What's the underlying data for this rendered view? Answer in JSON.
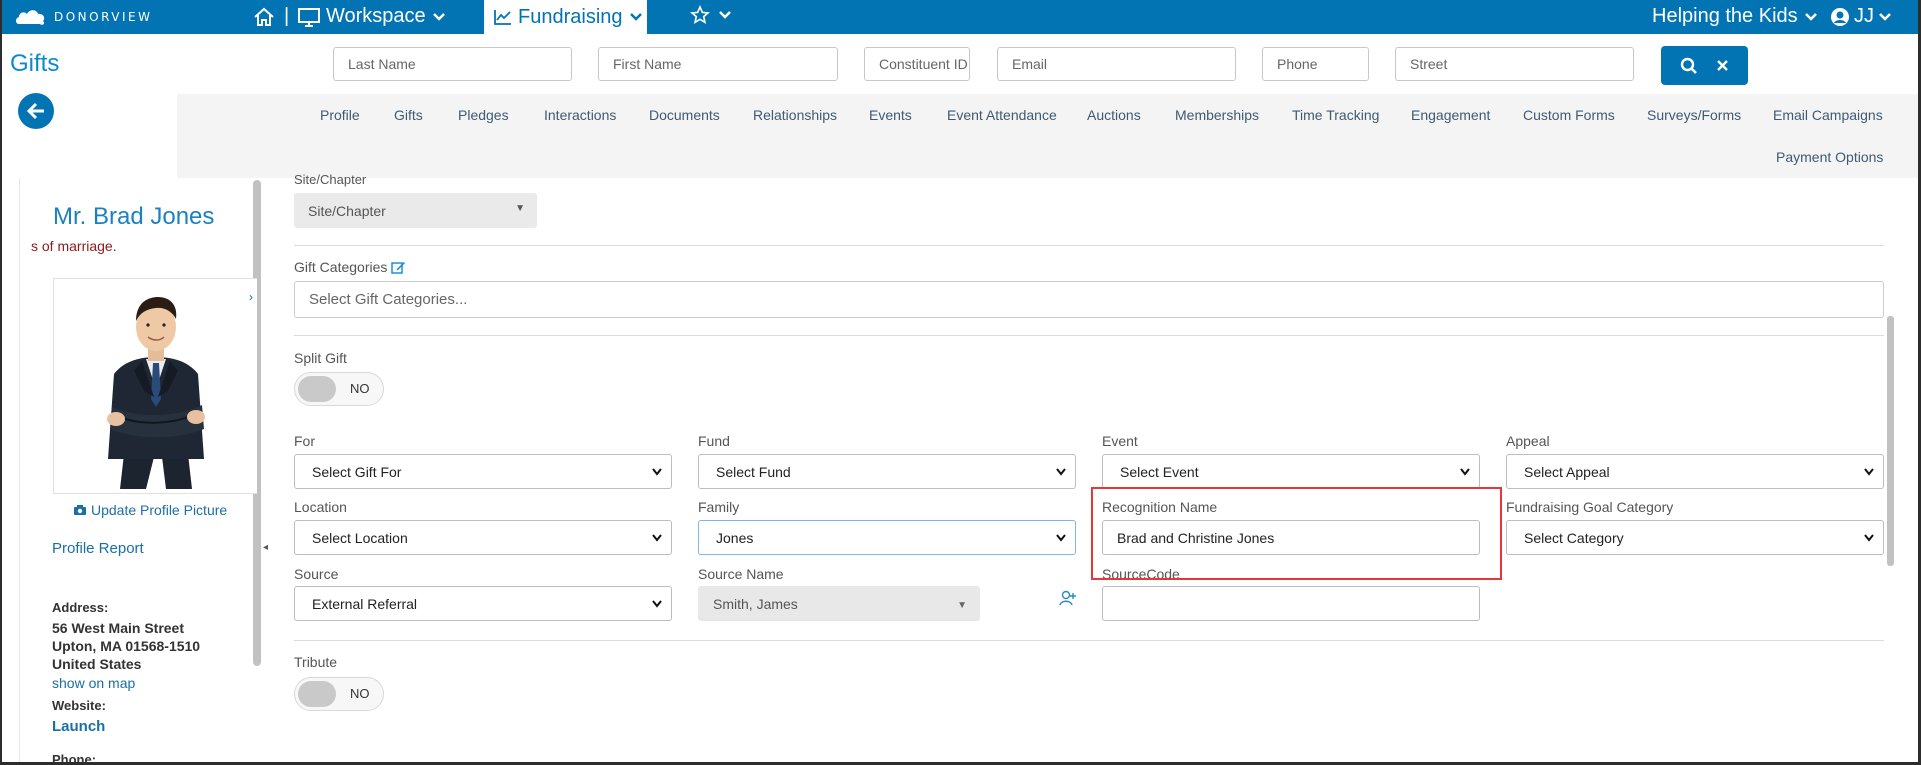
{
  "brand": {
    "logo_text": "DONORVIEW"
  },
  "topnav": {
    "separator": "|",
    "workspace_label": "Workspace",
    "fundraising_label": "Fundraising",
    "org_label": "Helping the Kids",
    "user_initials": "JJ"
  },
  "page": {
    "title": "Gifts"
  },
  "search": {
    "last_name": "Last Name",
    "first_name": "First Name",
    "constituent_id": "Constituent ID",
    "email": "Email",
    "phone": "Phone",
    "street": "Street"
  },
  "tabs": [
    "Profile",
    "Gifts",
    "Pledges",
    "Interactions",
    "Documents",
    "Relationships",
    "Events",
    "Event Attendance",
    "Auctions",
    "Memberships",
    "Time Tracking",
    "Engagement",
    "Custom Forms",
    "Surveys/Forms",
    "Email Campaigns",
    "Payment Options"
  ],
  "profile": {
    "name": "Mr. Brad Jones",
    "note": "s of marriage.",
    "update_picture": "Update Profile Picture",
    "profile_report": "Profile Report",
    "address_label": "Address:",
    "address_line1": "56 West Main Street",
    "address_line2": "Upton, MA 01568-1510",
    "address_line3": "United States",
    "show_on_map": "show on map",
    "website_label": "Website:",
    "launch": "Launch",
    "phone_label": "Phone:"
  },
  "form": {
    "site_label": "Site/Chapter",
    "site_value": "Site/Chapter",
    "gift_categories_label": "Gift Categories",
    "gift_categories_placeholder": "Select Gift Categories...",
    "split_gift_label": "Split Gift",
    "split_gift_toggle": "NO",
    "for_label": "For",
    "for_value": "Select Gift For",
    "fund_label": "Fund",
    "fund_value": "Select Fund",
    "event_label": "Event",
    "event_value": "Select Event",
    "appeal_label": "Appeal",
    "appeal_value": "Select Appeal",
    "location_label": "Location",
    "location_value": "Select Location",
    "family_label": "Family",
    "family_value": "Jones",
    "recognition_label": "Recognition Name",
    "recognition_value": "Brad and Christine Jones",
    "goal_category_label": "Fundraising Goal Category",
    "goal_category_value": "Select Category",
    "source_label": "Source",
    "source_value": "External Referral",
    "source_name_label": "Source Name",
    "source_name_value": "Smith, James",
    "sourcecode_label": "SourceCode",
    "sourcecode_value": "",
    "tribute_label": "Tribute",
    "tribute_toggle": "NO"
  },
  "colors": {
    "brand_blue": "#0274b4",
    "highlight_red": "#e23a3a"
  }
}
